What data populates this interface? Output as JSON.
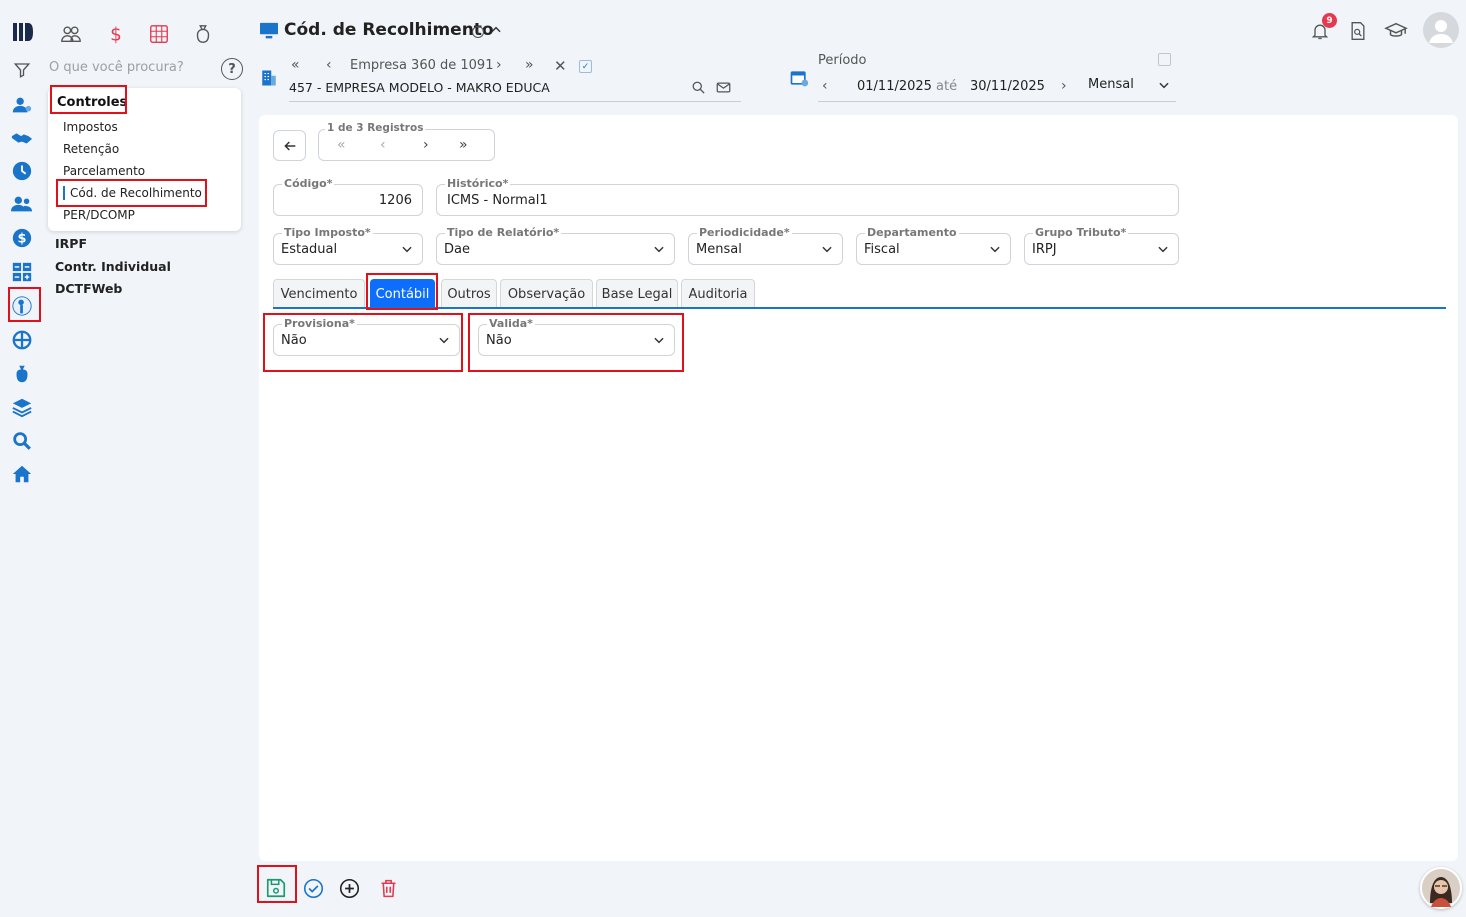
{
  "header": {
    "title": "Cód. de Recolhimento",
    "notification_count": "9"
  },
  "search": {
    "placeholder": "O que você procura?"
  },
  "company": {
    "nav_label": "Empresa 360 de 1091",
    "name": "457 - EMPRESA MODELO - MAKRO EDUCA"
  },
  "period": {
    "label": "Período",
    "start": "01/11/2025",
    "until": "até",
    "end": "30/11/2025",
    "mode": "Mensal"
  },
  "menu": {
    "section": "Controles",
    "items": [
      "Impostos",
      "Retenção",
      "Parcelamento",
      "Cód. de Recolhimento",
      "PER/DCOMP"
    ],
    "sections": [
      "IRPF",
      "Contr. Individual",
      "DCTFWeb"
    ]
  },
  "records": {
    "label": "1 de 3 Registros"
  },
  "form": {
    "codigo": {
      "label": "Código*",
      "value": "1206"
    },
    "historico": {
      "label": "Histórico*",
      "value": "ICMS - Normal1"
    },
    "tipo_imposto": {
      "label": "Tipo Imposto*",
      "value": "Estadual"
    },
    "tipo_relatorio": {
      "label": "Tipo de Relatório*",
      "value": "Dae"
    },
    "periodicidade": {
      "label": "Periodicidade*",
      "value": "Mensal"
    },
    "departamento": {
      "label": "Departamento",
      "value": "Fiscal"
    },
    "grupo_tributo": {
      "label": "Grupo Tributo*",
      "value": "IRPJ"
    }
  },
  "tabs": [
    "Vencimento",
    "Contábil",
    "Outros",
    "Observação",
    "Base Legal",
    "Auditoria"
  ],
  "active_tab": "Contábil",
  "contabil": {
    "provisiona": {
      "label": "Provisiona*",
      "value": "Não"
    },
    "valida": {
      "label": "Valida*",
      "value": "Não"
    }
  },
  "colors": {
    "accent": "#0d6efd",
    "highlight": "#e0111b",
    "rail_icon": "#1a74c9",
    "danger": "#e53950",
    "save": "#1a9a6c"
  }
}
